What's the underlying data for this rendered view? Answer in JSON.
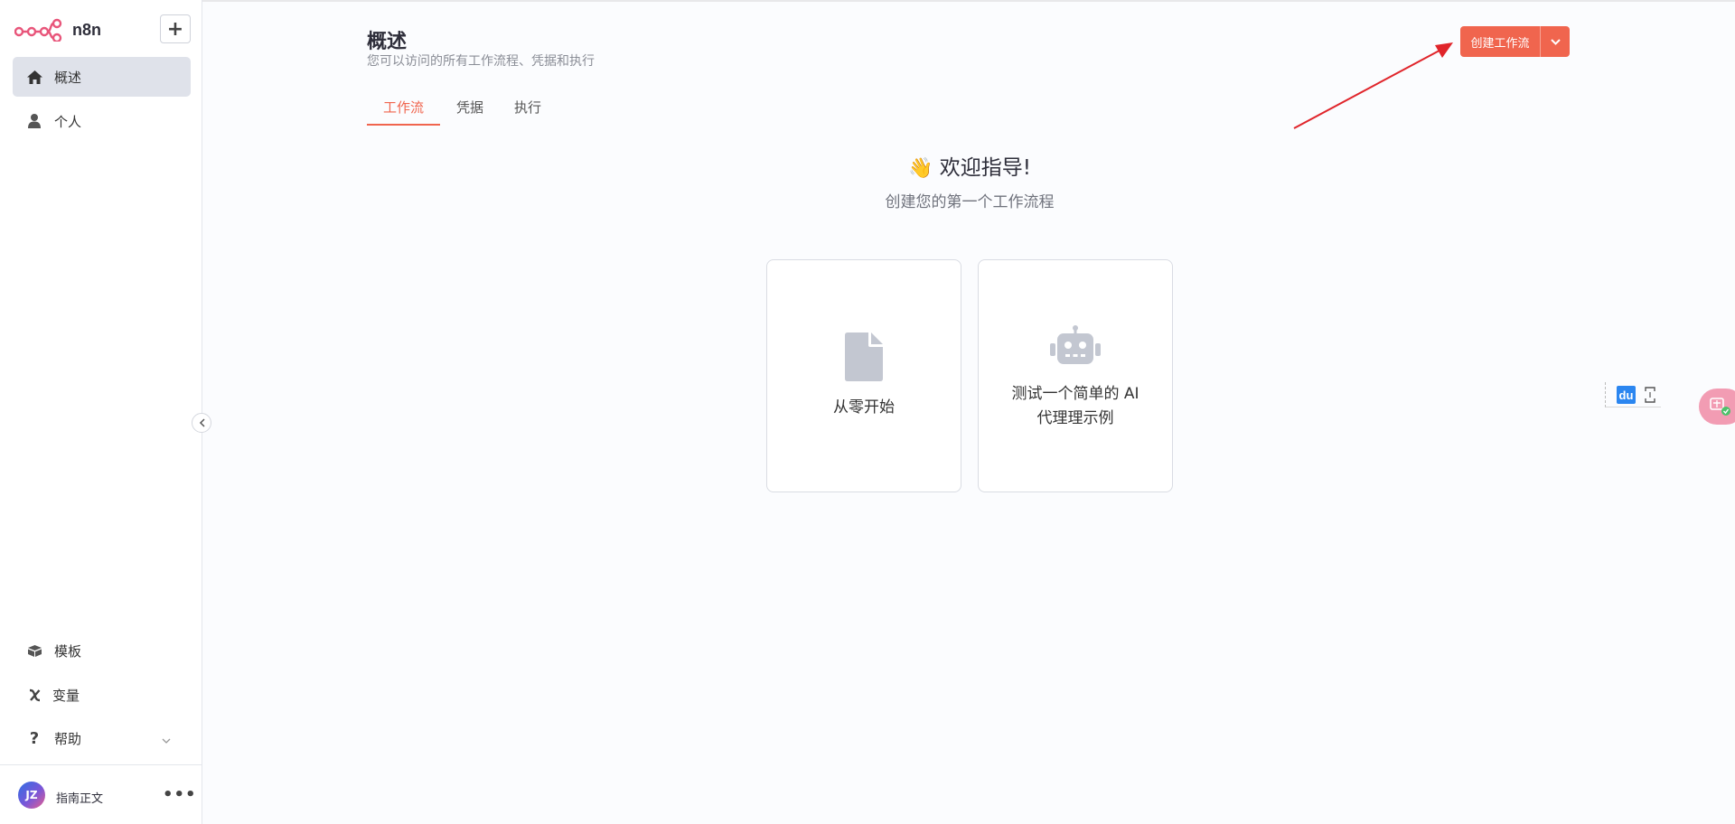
{
  "app": {
    "name": "n8n",
    "brand_color": "#f0654e"
  },
  "sidebar": {
    "add_label": "+",
    "top_items": [
      {
        "label": "概述",
        "icon": "home-icon",
        "active": true
      },
      {
        "label": "个人",
        "icon": "user-icon",
        "active": false
      }
    ],
    "bottom_items": [
      {
        "label": "模板",
        "icon": "box-icon"
      },
      {
        "label": "变量",
        "icon": "variable-icon"
      },
      {
        "label": "帮助",
        "icon": "question-icon"
      }
    ],
    "user": {
      "initials": "JZ",
      "name": "指南正文",
      "more": "•••"
    }
  },
  "header": {
    "title": "概述",
    "subtitle": "您可以访问的所有工作流程、凭据和执行",
    "create_button": "创建工作流"
  },
  "tabs": [
    {
      "label": "工作流",
      "active": true
    },
    {
      "label": "凭据",
      "active": false
    },
    {
      "label": "执行",
      "active": false
    }
  ],
  "welcome": {
    "emoji": "👋",
    "title": "欢迎指导!",
    "subtitle": "创建您的第一个工作流程"
  },
  "cards": [
    {
      "label": "从零开始",
      "icon": "file-icon"
    },
    {
      "label": "测试一个简单的 AI 代理理示例",
      "icon": "robot-icon"
    }
  ],
  "widgets": {
    "du_label": "du"
  }
}
